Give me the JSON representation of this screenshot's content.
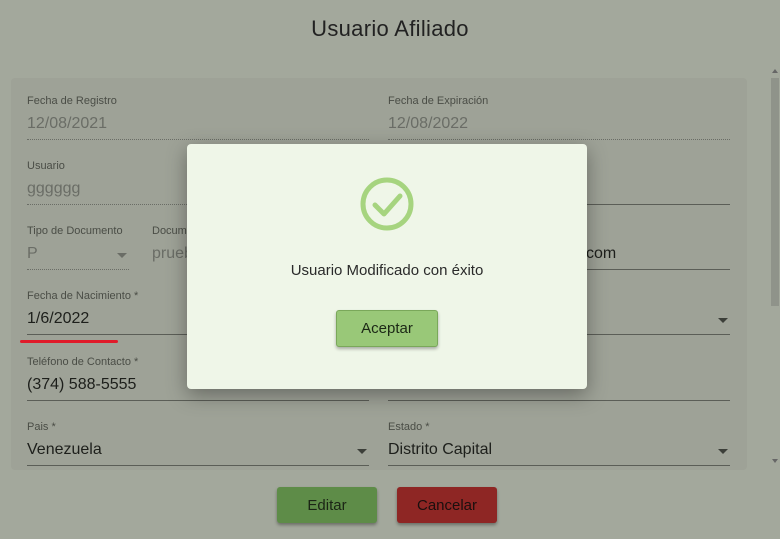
{
  "page": {
    "title": "Usuario Afiliado"
  },
  "form": {
    "fecha_registro": {
      "label": "Fecha de Registro",
      "value": "12/08/2021"
    },
    "fecha_expiracion": {
      "label": "Fecha de Expiración",
      "value": "12/08/2022"
    },
    "usuario": {
      "label": "Usuario",
      "value": "gggggg"
    },
    "tipo_documento": {
      "label": "Tipo de Documento",
      "value": "P"
    },
    "documento": {
      "label": "Docum",
      "value": "prueb"
    },
    "email": {
      "value": "com"
    },
    "fecha_nacimiento": {
      "label": "Fecha de Nacimiento *",
      "value": "1/6/2022"
    },
    "telefono": {
      "label": "Teléfono de Contacto *",
      "value": "(374) 588-5555"
    },
    "pais": {
      "label": "Pais *",
      "value": "Venezuela"
    },
    "estado": {
      "label": "Estado *",
      "value": "Distrito Capital"
    }
  },
  "actions": {
    "edit_label": "Editar",
    "cancel_label": "Cancelar"
  },
  "dialog": {
    "icon": "check-circle-icon",
    "message": "Usuario Modificado con éxito",
    "accept_label": "Aceptar"
  },
  "colors": {
    "success": "#a6d47f",
    "edit_button": "#5e8c48",
    "cancel_button": "#8e2624",
    "accept_button": "#99c878",
    "highlight_underline": "#e01b2a"
  }
}
